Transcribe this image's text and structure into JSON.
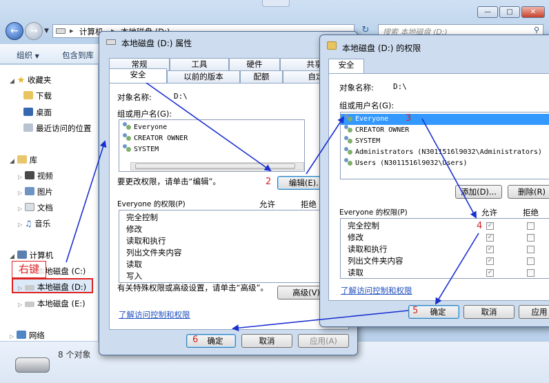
{
  "explorer": {
    "breadcrumb": [
      "计算机",
      "本地磁盘 (D:)"
    ],
    "search_placeholder": "搜索 本地磁盘 (D:)",
    "toolbar": {
      "organize": "组织",
      "include": "包含到库"
    },
    "nav": {
      "favorites": "收藏夹",
      "downloads": "下载",
      "desktop": "桌面",
      "recent": "最近访问的位置",
      "libraries": "库",
      "videos": "视频",
      "pictures": "图片",
      "documents": "文档",
      "music": "音乐",
      "computer": "计算机",
      "drive_c": "本地磁盘 (C:)",
      "drive_d": "本地磁盘 (D:)",
      "drive_e": "本地磁盘 (E:)",
      "network": "网络"
    },
    "status": "8 个对象"
  },
  "properties": {
    "title": "本地磁盘 (D:) 属性",
    "tabs_top": [
      "常规",
      "工具",
      "硬件",
      "共享"
    ],
    "tabs_bottom": [
      "安全",
      "以前的版本",
      "配额",
      "自定"
    ],
    "object_label": "对象名称:",
    "object_value": "D:\\",
    "group_label": "组或用户名(G):",
    "users": [
      "Everyone",
      "CREATOR OWNER",
      "SYSTEM"
    ],
    "edit_hint": "要更改权限，请单击“编辑”。",
    "edit_button": "编辑(E)...",
    "perm_header": "Everyone 的权限(P)",
    "allow": "允许",
    "deny": "拒绝",
    "perms": [
      "完全控制",
      "修改",
      "读取和执行",
      "列出文件夹内容",
      "读取",
      "写入"
    ],
    "special_hint": "有关特殊权限或高级设置，请单击“高级”。",
    "advanced_button": "高级(V)",
    "link": "了解访问控制和权限",
    "ok": "确定",
    "cancel": "取消",
    "apply": "应用(A)"
  },
  "permissions": {
    "title": "本地磁盘 (D:) 的权限",
    "tab": "安全",
    "object_label": "对象名称:",
    "object_value": "D:\\",
    "group_label": "组或用户名(G):",
    "users": [
      "Everyone",
      "CREATOR OWNER",
      "SYSTEM",
      "Administrators (N3011516l9032\\Administrators)",
      "Users (N3011516l9032\\Users)"
    ],
    "add_button": "添加(D)...",
    "remove_button": "删除(R)",
    "perm_header": "Everyone 的权限(P)",
    "allow": "允许",
    "deny": "拒绝",
    "perms": [
      "完全控制",
      "修改",
      "读取和执行",
      "列出文件夹内容",
      "读取"
    ],
    "allowed_checked": [
      true,
      true,
      true,
      true,
      true
    ],
    "link": "了解访问控制和权限",
    "ok": "确定",
    "cancel": "取消",
    "apply": "应用"
  },
  "annotations": {
    "right_click": "右键",
    "step1": "1",
    "step2": "2",
    "step3": "3",
    "step4": "4",
    "step5": "5",
    "step6": "6",
    "arrow_color": "#1a2fd0",
    "highlight_color": "#e02020"
  }
}
